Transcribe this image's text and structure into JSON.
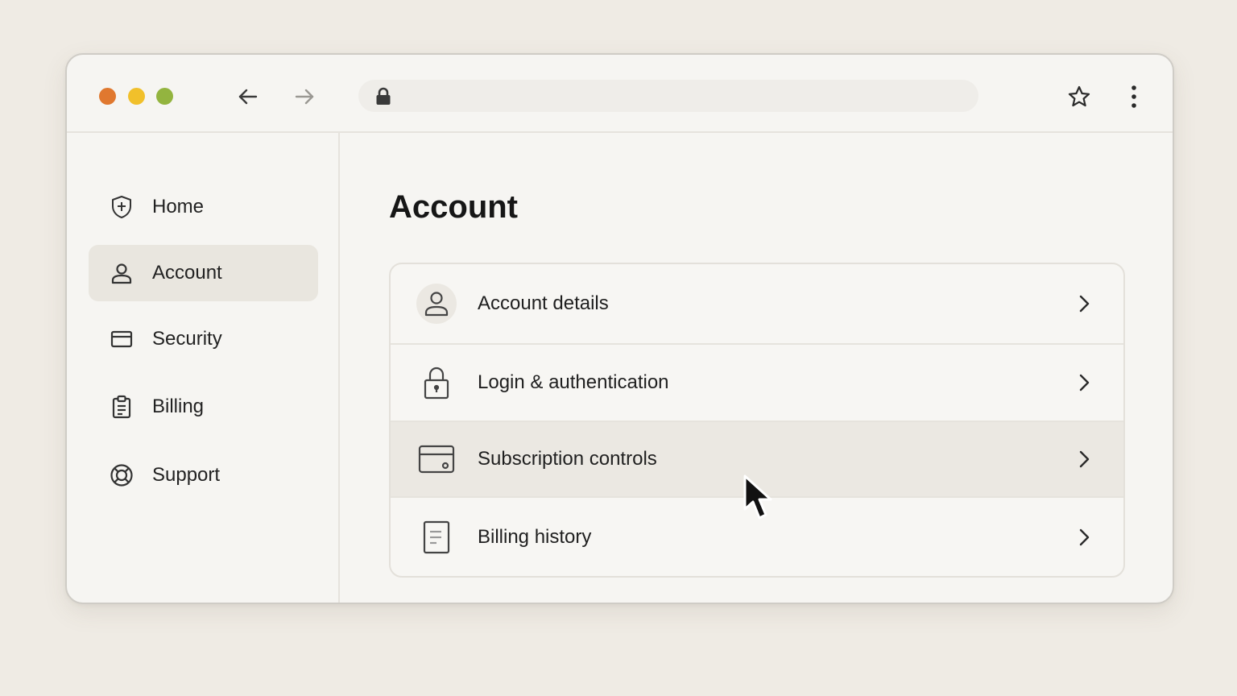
{
  "browser": {
    "back_icon": "arrow-left-icon",
    "forward_icon": "arrow-right-icon",
    "address_icon": "lock-icon",
    "address_value": "",
    "bookmark_icon": "star-icon",
    "menu_icon": "more-vertical-icon",
    "window_controls": {
      "close_color": "#e0782f",
      "minimize_color": "#f1c02b",
      "maximize_color": "#93b43f"
    }
  },
  "sidebar": {
    "active_index": 1,
    "items": [
      {
        "label": "Home",
        "icon": "shield-icon"
      },
      {
        "label": "Account",
        "icon": "user-icon"
      },
      {
        "label": "Security",
        "icon": "credit-card-icon"
      },
      {
        "label": "Billing",
        "icon": "clipboard-icon"
      },
      {
        "label": "Support",
        "icon": "lifebuoy-icon"
      }
    ]
  },
  "main": {
    "title": "Account",
    "rows": [
      {
        "label": "Account details",
        "icon": "user-icon"
      },
      {
        "label": "Login & authentication",
        "icon": "lock-icon"
      },
      {
        "label": "Subscription controls",
        "icon": "credit-card-icon"
      },
      {
        "label": "Billing history",
        "icon": "document-icon"
      }
    ],
    "hovered_row_index": 2
  },
  "colors": {
    "background": "#efebe4",
    "window": "#f6f5f2",
    "active_item": "#e9e6df",
    "hover_row": "#ebe8e2",
    "text": "#1f1f1f"
  }
}
